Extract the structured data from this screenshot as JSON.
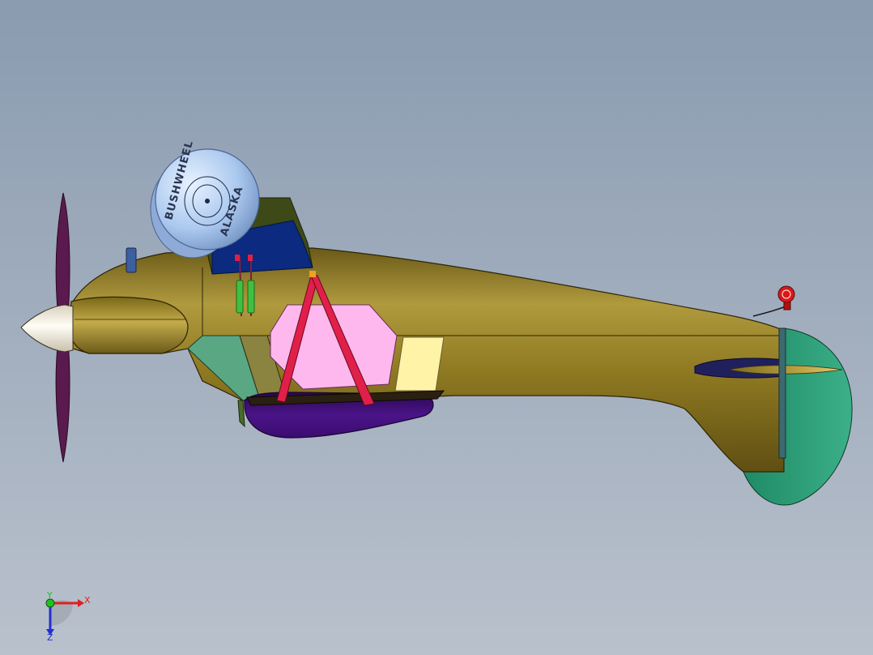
{
  "viewport": {
    "background_top": "#8a9bb0",
    "background_bottom": "#b9c1cc"
  },
  "model": {
    "wheel_brand": "BUSHWHEEL",
    "wheel_model": "ALASKA",
    "colors": {
      "fuselage": "#8f7a22",
      "fuselage_light": "#c3ab4a",
      "fuselage_dark": "#5f4f12",
      "propeller": "#5a1a4e",
      "spinner": "#f4f0e6",
      "wheel": "#aac8ee",
      "window": "#0b2a80",
      "strut": "#e0204a",
      "panel_pink": "#ffb8ee",
      "panel_yellow": "#fff3a8",
      "panel_green": "#5aa784",
      "float": "#3c0c70",
      "tail": "#2d9a74",
      "stabilizer": "#20205c",
      "exhaust": "#3c5fa0",
      "shock_absorber": "#40c040",
      "beacon": "#d81818"
    }
  },
  "triad": {
    "x_label": "X",
    "y_label": "Y",
    "z_label": "Z",
    "x_color": "#e02020",
    "y_color": "#20c020",
    "z_color": "#2030d0"
  }
}
